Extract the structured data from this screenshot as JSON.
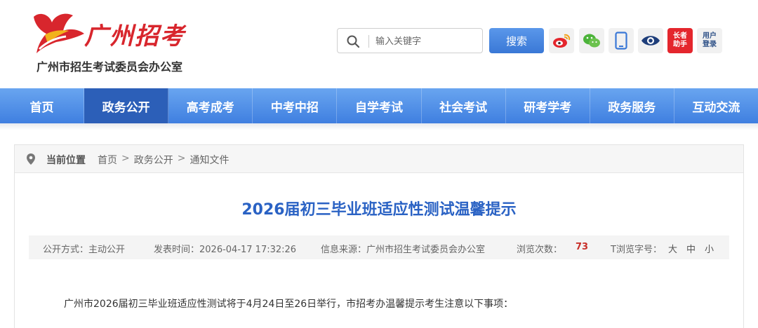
{
  "header": {
    "logo_script": "广州招考",
    "org_name": "广州市招生考试委员会办公室",
    "search": {
      "placeholder": "输入关键字",
      "value": "",
      "button_label": "搜索"
    },
    "quick_links": [
      {
        "icon": "weibo-icon"
      },
      {
        "icon": "wechat-icon"
      },
      {
        "icon": "mobile-icon"
      },
      {
        "icon": "eye-icon"
      },
      {
        "icon": "elder-helper-icon",
        "label_top": "长者",
        "label_bottom": "助手"
      },
      {
        "icon": "user-login-icon",
        "label_top": "用户",
        "label_bottom": "登录"
      }
    ]
  },
  "nav": {
    "items": [
      "首页",
      "政务公开",
      "高考成考",
      "中考中招",
      "自学考试",
      "社会考试",
      "研考学考",
      "政务服务",
      "互动交流"
    ],
    "active_index": 1
  },
  "breadcrumb": {
    "label": "当前位置",
    "path": [
      "首页",
      "政务公开",
      "通知文件"
    ],
    "separator": ">"
  },
  "article": {
    "title": "2026届初三毕业班适应性测试温馨提示",
    "meta": {
      "disclosure": "公开方式：主动公开",
      "published": "发表时间：2026-04-17 17:32:26",
      "source": "信息来源：广州市招生考试委员会办公室",
      "views_label": "浏览次数：",
      "views": "73",
      "font_size_label": "T浏览字号：",
      "font_sizes": [
        "大",
        "中",
        "小"
      ]
    },
    "first_paragraph": "广州市2026届初三毕业班适应性测试将于4月24日至26日举行，市招考办温馨提示考生注意以下事项："
  },
  "colors": {
    "brand_red": "#d8262d",
    "nav_blue": "#3f7fe0",
    "nav_active": "#2c5fb8",
    "title_blue": "#2a62c4",
    "views_red": "#c8302a"
  }
}
